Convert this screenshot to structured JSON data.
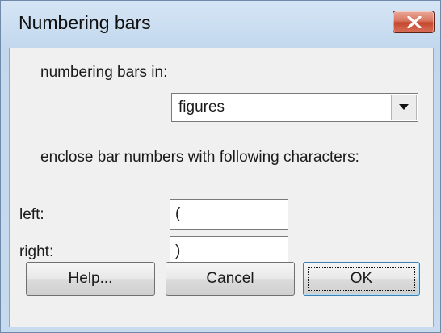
{
  "window": {
    "title": "Numbering bars"
  },
  "form": {
    "numbering_label": "numbering bars in:",
    "numbering_value": "figures",
    "enclose_label": "enclose bar numbers with following characters:",
    "left_label": "left:",
    "left_value": "(",
    "right_label": "right:",
    "right_value": ")"
  },
  "buttons": {
    "help_label": "Help...",
    "cancel_label": "Cancel",
    "ok_label": "OK"
  },
  "colors": {
    "close_button": "#c5472d",
    "titlebar": "#c7daee",
    "dialog_background": "#f0f0f0"
  },
  "icons": {
    "close": "close-icon",
    "dropdown": "chevron-down-icon"
  }
}
